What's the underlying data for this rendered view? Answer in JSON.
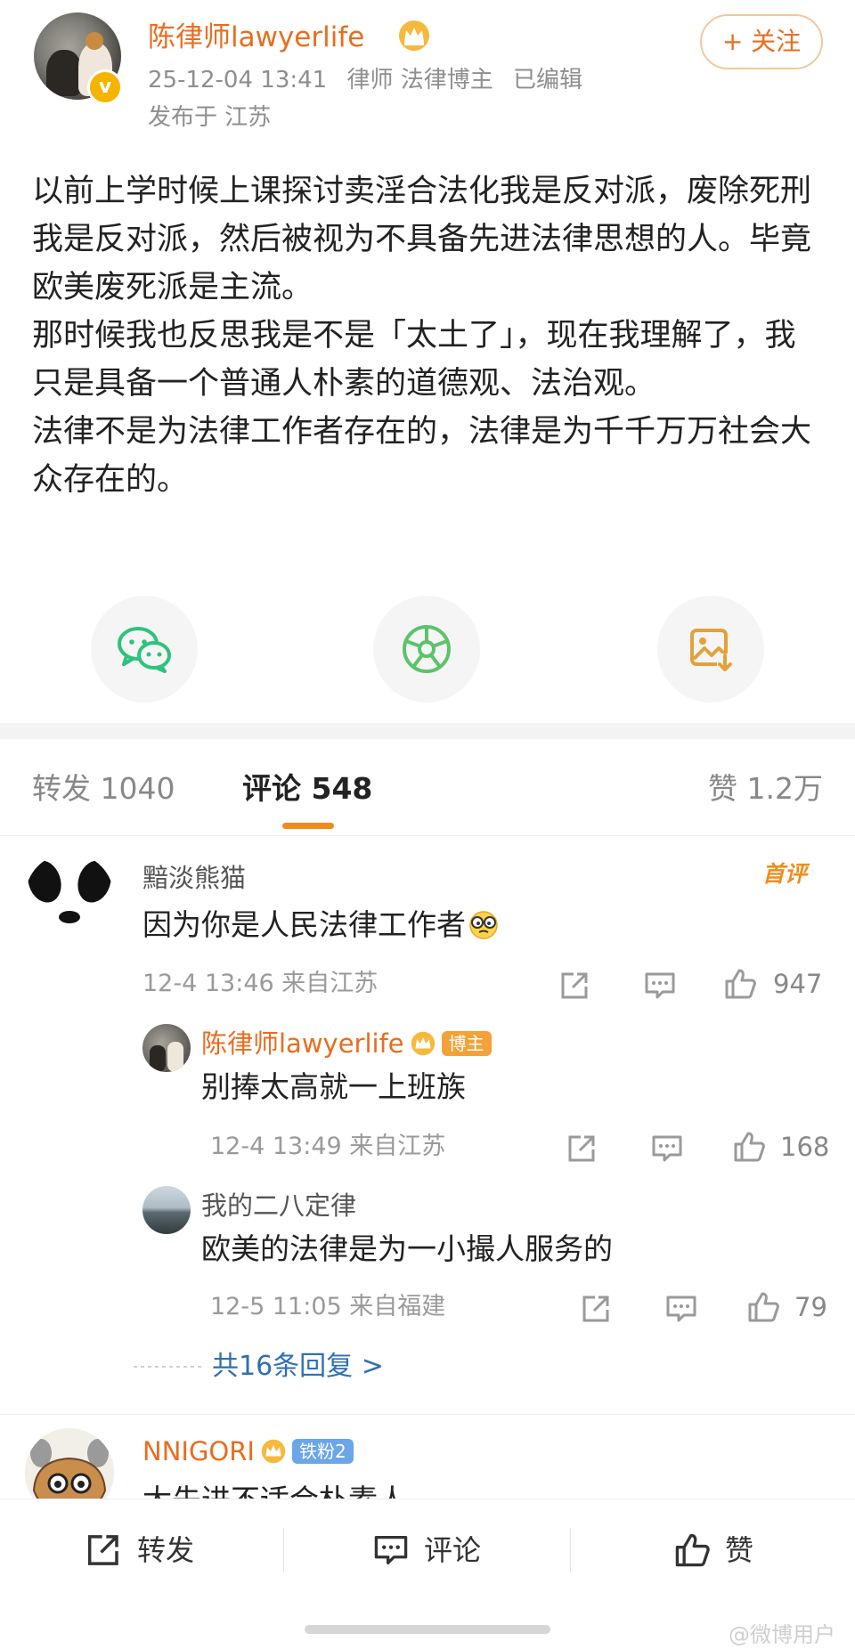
{
  "post": {
    "author": "陈律师lawyerlife",
    "follow_label": "+ 关注",
    "meta": [
      "25-12-04 13:41",
      "律师 法律博主",
      "已编辑"
    ],
    "location": "发布于 江苏",
    "paragraphs": [
      "以前上学时候上课探讨卖淫合法化我是反对派，废除死刑我是反对派，然后被视为不具备先进法律思想的人。毕竟欧美废死派是主流。",
      "那时候我也反思我是不是「太土了」，现在我理解了，我只是具备一个普通人朴素的道德观、法治观。",
      "法律不是为法律工作者存在的，法律是为千千万万社会大众存在的。"
    ],
    "share_icons": [
      "wechat-icon",
      "moments-icon",
      "save-image-icon"
    ]
  },
  "tabs": {
    "repost": "转发 1040",
    "comment": "评论 548",
    "like": "赞 1.2万"
  },
  "comments": [
    {
      "user": "黯淡熊猫",
      "badge": "首评",
      "text": "因为你是人民法律工作者",
      "meta": "12-4 13:46 来自江苏",
      "likes": "947",
      "replies": [
        {
          "user": "陈律师lawyerlife",
          "tag": "博主",
          "text": "别捧太高就一上班族",
          "meta": "12-4 13:49 来自江苏",
          "likes": "168"
        },
        {
          "user": "我的二八定律",
          "text": "欧美的法律是为一小撮人服务的",
          "meta": "12-5 11:05 来自福建",
          "likes": "79"
        }
      ],
      "reply_count": "共16条回复 >"
    },
    {
      "user": "NNIGORI",
      "tag": "铁粉2",
      "text": "太先进不适合朴素人"
    }
  ],
  "bottom_bar": {
    "repost": "转发",
    "comment": "评论",
    "like": "赞"
  },
  "watermark": "@微博用户",
  "colors": {
    "accent": "#e86d1f",
    "link": "#2e6fb4",
    "tab_indicator": "#f08c1c",
    "meta_gray": "#8e8e8e"
  }
}
